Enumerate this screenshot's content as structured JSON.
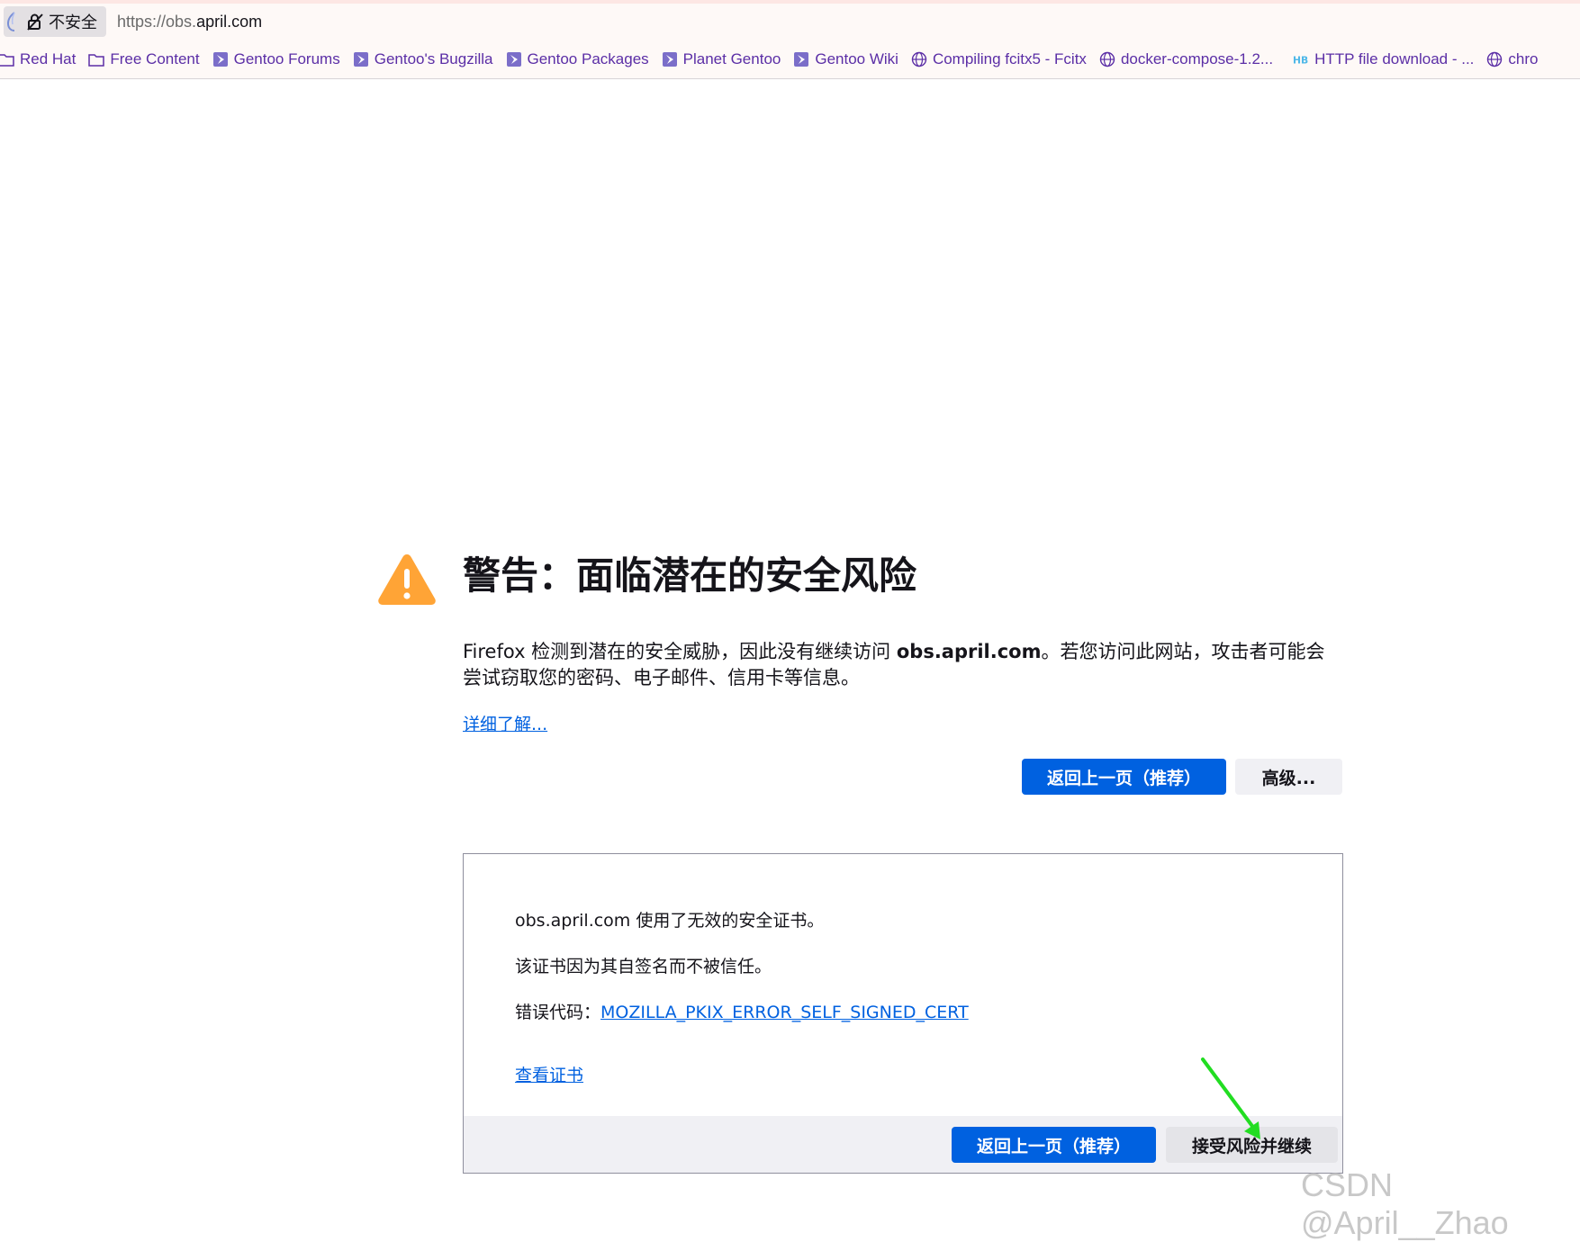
{
  "urlbar": {
    "security_label": "不安全",
    "url_scheme": "https://obs.",
    "url_host": "april.com"
  },
  "bookmarks": [
    {
      "label": "Red Hat",
      "icon": "folder-icon"
    },
    {
      "label": "Free Content",
      "icon": "folder-icon"
    },
    {
      "label": "Gentoo Forums",
      "icon": "gentoo-icon"
    },
    {
      "label": "Gentoo's Bugzilla",
      "icon": "gentoo-icon"
    },
    {
      "label": "Gentoo Packages",
      "icon": "gentoo-icon"
    },
    {
      "label": "Planet Gentoo",
      "icon": "gentoo-icon"
    },
    {
      "label": "Gentoo Wiki",
      "icon": "gentoo-icon"
    },
    {
      "label": "Compiling fcitx5 - Fcitx",
      "icon": "globe-icon"
    },
    {
      "label": "docker-compose-1.2...",
      "icon": "globe-icon"
    },
    {
      "label": "HTTP file download - ...",
      "icon": "hb-icon"
    },
    {
      "label": "chro",
      "icon": "globe-icon"
    }
  ],
  "warning": {
    "title": "警告：面临潜在的安全风险",
    "desc_before": "Firefox 检测到潜在的安全威胁，因此没有继续访问 ",
    "desc_host": "obs.april.com",
    "desc_after": "。若您访问此网站，攻击者可能会尝试窃取您的密码、电子邮件、信用卡等信息。",
    "learn_more": "详细了解...",
    "go_back": "返回上一页（推荐）",
    "advanced": "高级..."
  },
  "advanced_panel": {
    "line1": "obs.april.com 使用了无效的安全证书。",
    "line2": "该证书因为其自签名而不被信任。",
    "error_label": "错误代码：",
    "error_code": "MOZILLA_PKIX_ERROR_SELF_SIGNED_CERT",
    "view_cert": "查看证书",
    "go_back": "返回上一页（推荐）",
    "accept": "接受风险并继续"
  },
  "watermark": "CSDN @April__Zhao",
  "colors": {
    "accent": "#0061e0",
    "warning": "#ffa436",
    "annotation_arrow": "#22dd22"
  }
}
